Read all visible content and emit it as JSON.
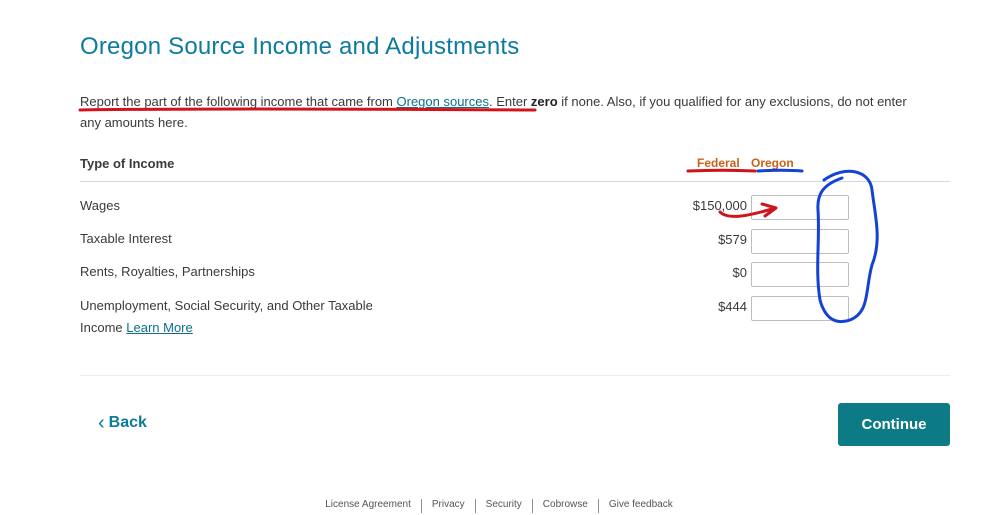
{
  "page": {
    "title": "Oregon Source Income and Adjustments"
  },
  "intro": {
    "part1": "Report the part of the following income that came from ",
    "link": "Oregon sources",
    "part2": ". Enter ",
    "bold": "zero",
    "part3": " if none. Also, if you qualified for any exclusions, do not enter any amounts here."
  },
  "table": {
    "headers": {
      "type": "Type of Income",
      "federal": "Federal",
      "oregon": "Oregon"
    },
    "rows": [
      {
        "label": "Wages",
        "federal": "$150,000",
        "oregon": ""
      },
      {
        "label": "Taxable Interest",
        "federal": "$579",
        "oregon": ""
      },
      {
        "label": "Rents, Royalties, Partnerships",
        "federal": "$0",
        "oregon": ""
      },
      {
        "label_line1": "Unemployment, Social Security, and Other Taxable",
        "label_line2": "Income",
        "link": "Learn More",
        "federal": "$444",
        "oregon": ""
      }
    ]
  },
  "nav": {
    "back_label": "Back",
    "continue_label": "Continue"
  },
  "footer": {
    "links": [
      "License Agreement",
      "Privacy",
      "Security",
      "Cobrowse",
      "Give feedback"
    ]
  },
  "colors": {
    "title": "#0d7ba0",
    "link": "#0d6e8c",
    "continue_bg": "#0d7b85",
    "header_accent": "#c8621a",
    "annotation_red": "#d0141c",
    "annotation_blue": "#1442d6"
  },
  "icons": {
    "back": "chevron-left-icon"
  }
}
